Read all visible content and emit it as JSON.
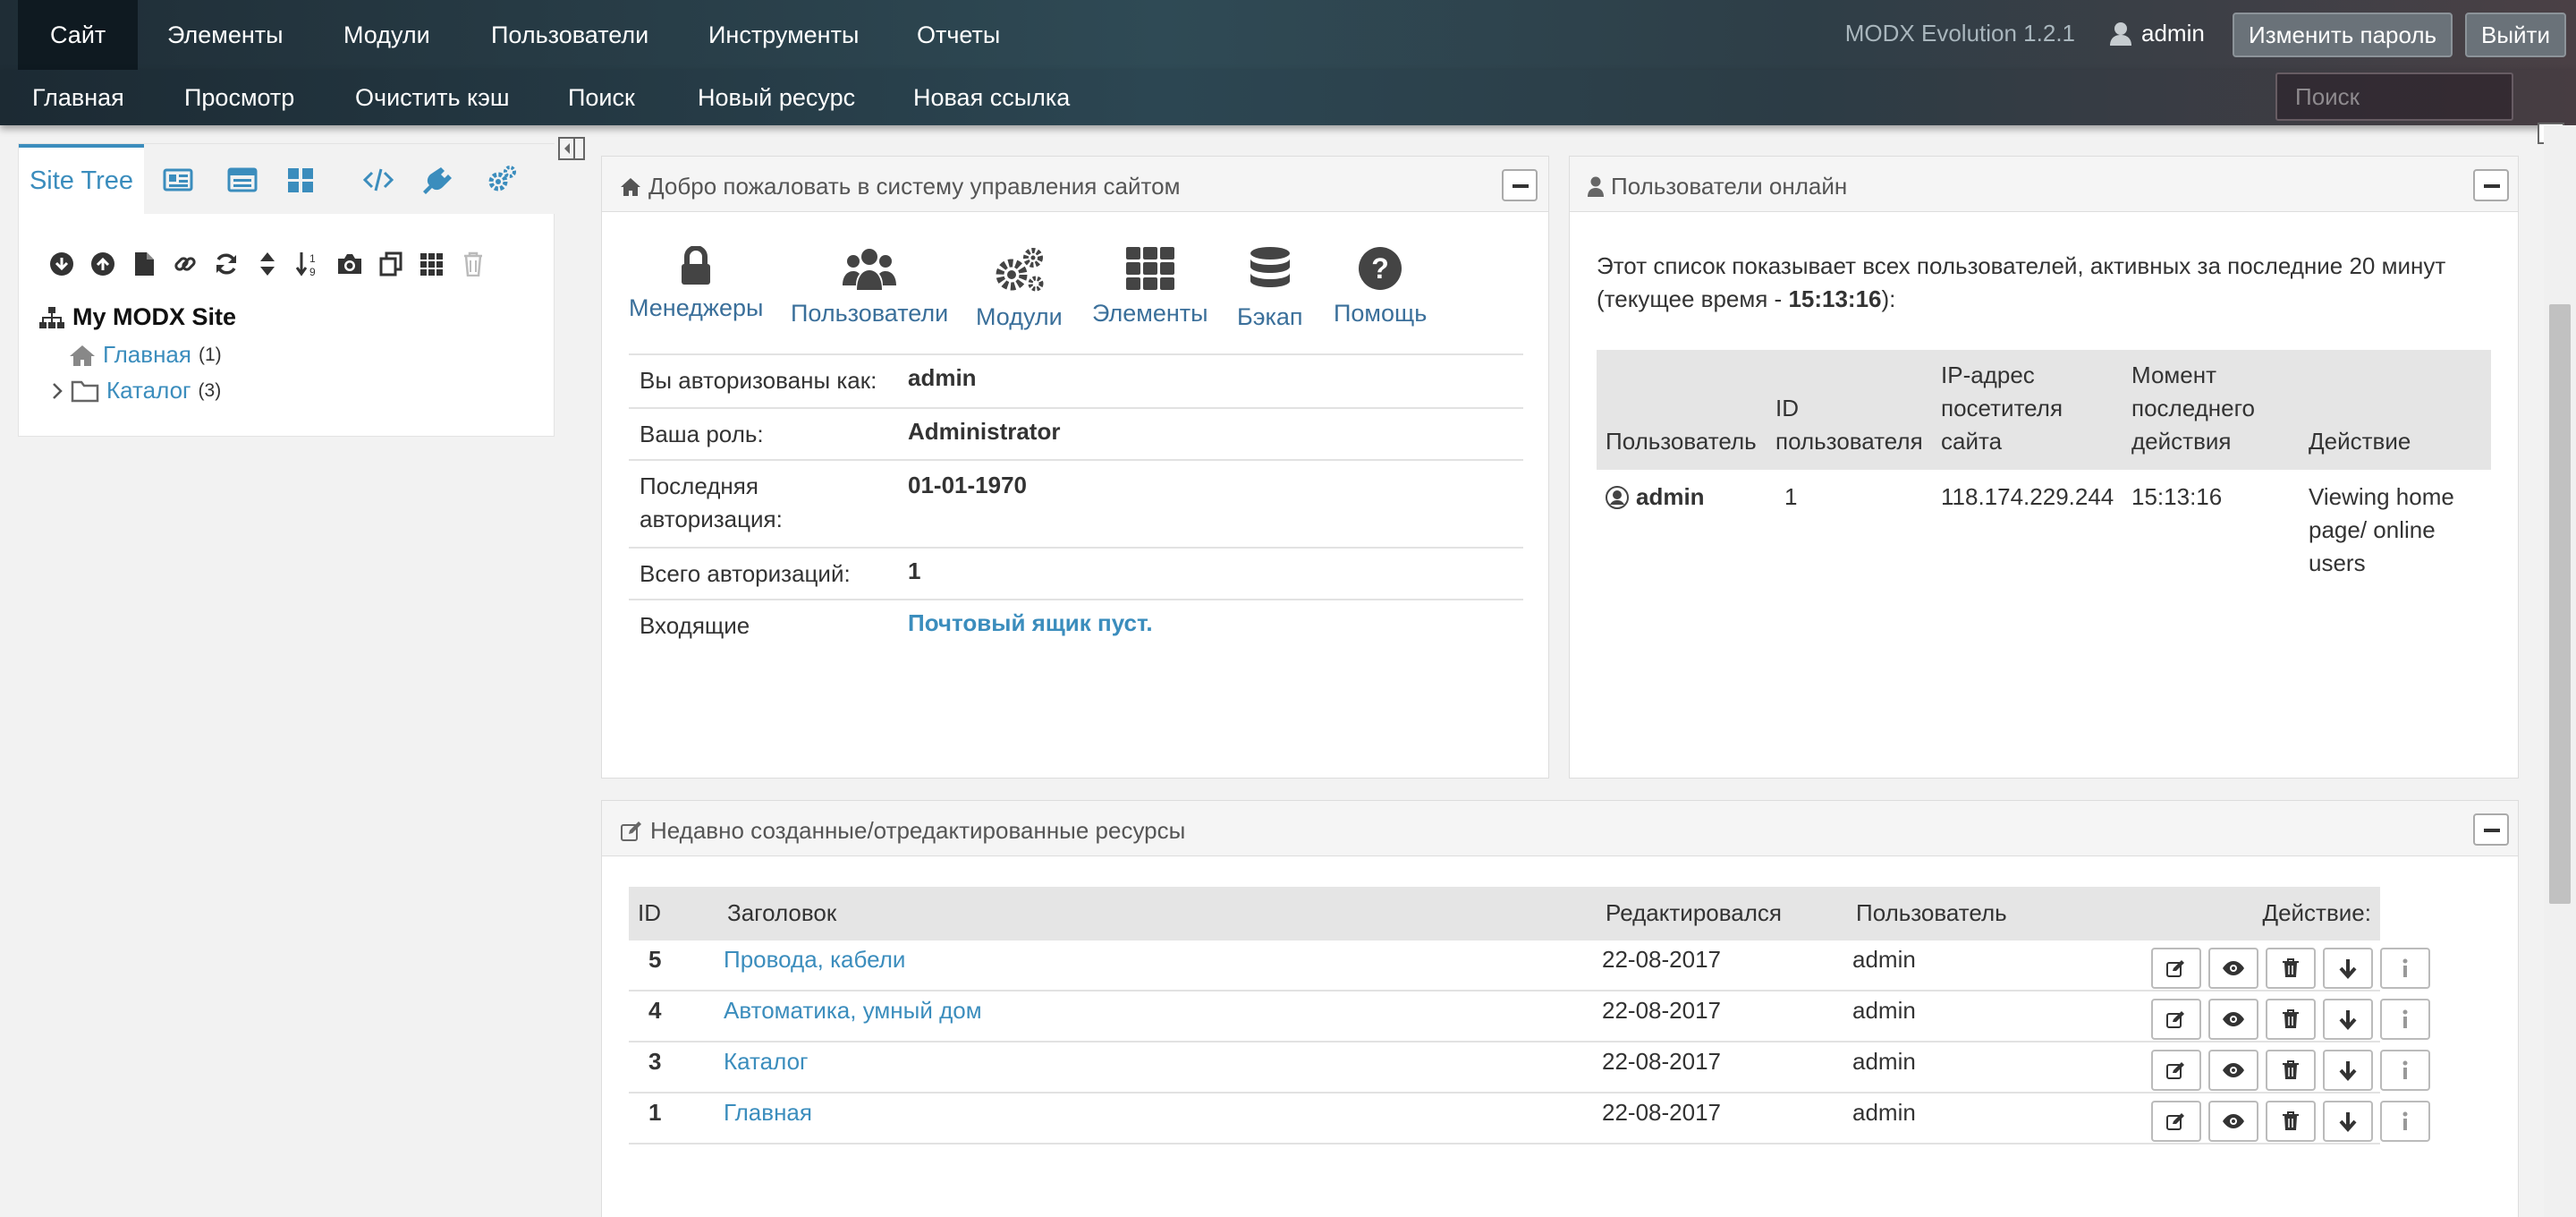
{
  "topnav": {
    "items": [
      "Сайт",
      "Элементы",
      "Модули",
      "Пользователи",
      "Инструменты",
      "Отчеты"
    ],
    "version": "MODX Evolution 1.2.1",
    "username": "admin",
    "change_password": "Изменить пароль",
    "logout": "Выйти"
  },
  "subnav": {
    "items": [
      "Главная",
      "Просмотр",
      "Очистить кэш",
      "Поиск",
      "Новый ресурс",
      "Новая ссылка"
    ],
    "search_placeholder": "Поиск"
  },
  "tree": {
    "tab_label": "Site Tree",
    "root": "My MODX Site",
    "nodes": [
      {
        "label": "Главная",
        "count": "(1)"
      },
      {
        "label": "Каталог",
        "count": "(3)"
      }
    ]
  },
  "welcome": {
    "title": "Добро пожаловать в систему управления сайтом",
    "icons": [
      "Менеджеры",
      "Пользователи",
      "Модули",
      "Элементы",
      "Бэкап",
      "Помощь"
    ],
    "rows": [
      {
        "label": "Вы авторизованы как:",
        "value": "admin"
      },
      {
        "label": "Ваша роль:",
        "value": "Administrator"
      },
      {
        "label": "Последняя авторизация:",
        "value": "01-01-1970"
      },
      {
        "label": "Всего авторизаций:",
        "value": "1"
      },
      {
        "label": "Входящие",
        "value": "Почтовый ящик пуст."
      }
    ]
  },
  "online": {
    "title": "Пользователи онлайн",
    "description": "Этот список показывает всех пользователей, активных за последние 20 минут (текущее время - ",
    "time": "15:13:16",
    "description_end": "):",
    "headers": [
      "Пользователь",
      "ID пользователя",
      "IP-адрес посетителя сайта",
      "Момент последнего действия",
      "Действие"
    ],
    "rows": [
      {
        "user": "admin",
        "id": "1",
        "ip": "118.174.229.244",
        "time": "15:13:16",
        "action": "Viewing home page/ online users"
      }
    ]
  },
  "recent": {
    "title": "Недавно созданные/отредактированные ресурсы",
    "headers": [
      "ID",
      "Заголовок",
      "Редактировался",
      "Пользователь",
      "Действие:"
    ],
    "rows": [
      {
        "id": "5",
        "title": "Провода, кабели",
        "date": "22-08-2017",
        "user": "admin"
      },
      {
        "id": "4",
        "title": "Автоматика, умный дом",
        "date": "22-08-2017",
        "user": "admin"
      },
      {
        "id": "3",
        "title": "Каталог",
        "date": "22-08-2017",
        "user": "admin"
      },
      {
        "id": "1",
        "title": "Главная",
        "date": "22-08-2017",
        "user": "admin"
      }
    ]
  },
  "colors": {
    "link": "#3b8dbd",
    "active_tab": "#0f1a21"
  }
}
